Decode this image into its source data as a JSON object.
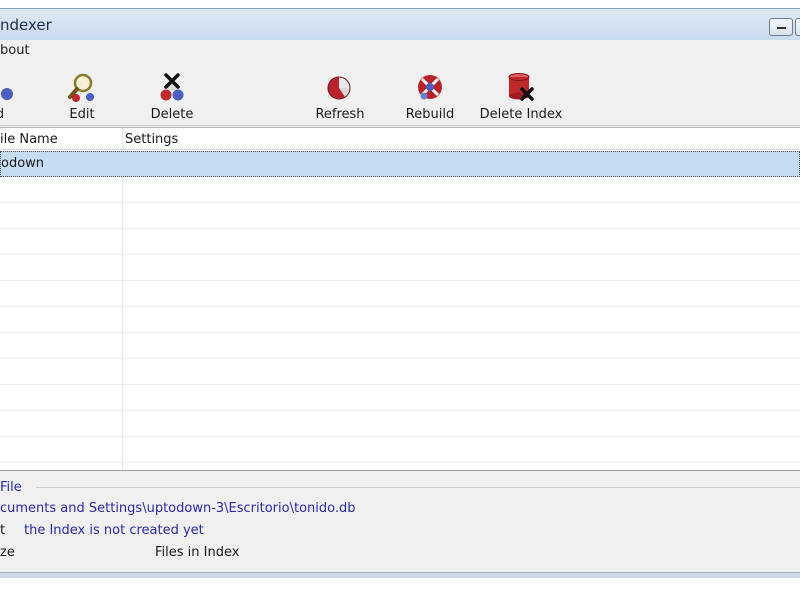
{
  "window": {
    "title": "ndexer"
  },
  "menu": {
    "items": [
      {
        "label": "bout"
      }
    ]
  },
  "toolbar": {
    "buttons": [
      {
        "label": "d",
        "icon": "add-icon"
      },
      {
        "label": "Edit",
        "icon": "magnifier-icon"
      },
      {
        "label": "Delete",
        "icon": "delete-x-icon"
      },
      {
        "label": "Refresh",
        "icon": "refresh-pie-icon"
      },
      {
        "label": "Rebuild",
        "icon": "rebuild-icon"
      },
      {
        "label": "Delete Index",
        "icon": "database-delete-icon"
      }
    ]
  },
  "list": {
    "columns": [
      "ile Name",
      "Settings"
    ],
    "rows": [
      {
        "name": "odown",
        "settings": "",
        "selected": true
      }
    ]
  },
  "info": {
    "group_label": "File",
    "path": "cuments and Settings\\uptodown-3\\Escritorio\\tonido.db",
    "status_label": "t",
    "status_value": "the Index is not created yet",
    "size_label": "ze",
    "files_label": "Files in Index"
  },
  "colors": {
    "selection": "#c6dcf3",
    "info_text": "#2a2aa8",
    "title_bar": "#c9dbef"
  }
}
